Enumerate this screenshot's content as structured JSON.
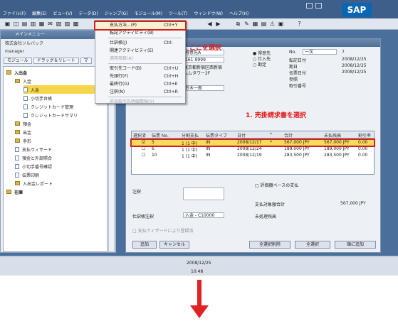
{
  "menubar": {
    "items": [
      "ファイル(F)",
      "編集(E)",
      "ビュー(V)",
      "データ(D)",
      "ジャンプ(G)",
      "モジュール(M)",
      "ツール(T)",
      "ウィンドウ(W)",
      "ヘルプ(H)"
    ],
    "logo": "SAP"
  },
  "left_panel": {
    "title": "メインメニュー",
    "company": "株式会社ソルパック",
    "user": "manager",
    "tabs": [
      "モジュール",
      "ドラッグ＆リレート",
      "マ"
    ],
    "tree": [
      {
        "label": "入出金",
        "level": 0,
        "kind": "folder"
      },
      {
        "label": "入金",
        "level": 1,
        "kind": "folder"
      },
      {
        "label": "入金",
        "level": 2,
        "kind": "doc",
        "selected": true
      },
      {
        "label": "小切手台帳",
        "level": 2,
        "kind": "doc"
      },
      {
        "label": "クレジットカード管理",
        "level": 2,
        "kind": "doc"
      },
      {
        "label": "クレジットカードサマリ",
        "level": 2,
        "kind": "doc"
      },
      {
        "label": "預金",
        "level": 1,
        "kind": "folder"
      },
      {
        "label": "出金",
        "level": 1,
        "kind": "folder"
      },
      {
        "label": "手形",
        "level": 1,
        "kind": "folder"
      },
      {
        "label": "支払ウィザード",
        "level": 1,
        "kind": "doc"
      },
      {
        "label": "預金と外部照合",
        "level": 1,
        "kind": "doc"
      },
      {
        "label": "小切手番号確認",
        "level": 1,
        "kind": "doc"
      },
      {
        "label": "伝票印刷",
        "level": 1,
        "kind": "doc"
      },
      {
        "label": "入出金レポート",
        "level": 1,
        "kind": "folder"
      },
      {
        "label": "在庫",
        "level": 0,
        "kind": "folder"
      }
    ]
  },
  "context_menu": {
    "items": [
      {
        "label": "支払方法...(P)",
        "shortcut": "Ctrl+Y",
        "highlighted": true
      },
      {
        "label": "転記アクティビティ(B)"
      },
      {
        "label": "仕訳帳(J)",
        "shortcut": "Ctrl-"
      },
      {
        "label": "関連アクティビティ(E)"
      },
      {
        "label": "適用項目(A)",
        "disabled": true
      },
      {
        "label": "取引先コード(B)",
        "shortcut": "Ctrl+U"
      },
      {
        "label": "先頭行(F)",
        "shortcut": "Ctrl+H"
      },
      {
        "label": "最終行(G)",
        "shortcut": "Ctrl+E"
      },
      {
        "label": "注釈(N)",
        "shortcut": "Ctrl+R"
      },
      {
        "label": "追加取引先明細情報(Y)",
        "disabled": true
      }
    ]
  },
  "annotations": {
    "step2": "2. ここを選択",
    "step1": "1. 売掛請求書を選択"
  },
  "form": {
    "header": {
      "partner_code": "得意先A",
      "phone": "161-9999",
      "address1": "東京都新宿区西新宿",
      "address2": "ムムタワー2F",
      "contact": "鈴木一郎",
      "radio_customer": "得意先",
      "radio_vendor": "仕入先",
      "radio_account": "勘定",
      "no_label": "No.",
      "no_series": "一次",
      "no_value": "7",
      "posting_date_label": "転記日付",
      "posting_date": "2008/12/25",
      "due_date_label": "期日",
      "due_date": "2008/12/25",
      "doc_date_label": "伝票日付",
      "doc_date": "2008/12/25",
      "reference_label": "参照",
      "transaction_no_label": "取引番号"
    },
    "grid": {
      "columns": [
        "選択済",
        "伝票 No.",
        "分割支払",
        "伝票タイプ",
        "日付",
        "*",
        "合計",
        "未払残高",
        "割引率"
      ],
      "rows": [
        {
          "selected": true,
          "doc_no": "5",
          "installment": "1 (1 中)",
          "type": "IN",
          "date": "2008/12/17",
          "flag": "*",
          "total": "567,000 JPY",
          "balance": "567,000 JPY",
          "discount": "0.00"
        },
        {
          "selected": false,
          "doc_no": "6",
          "installment": "1 (1 中)",
          "type": "IN",
          "date": "2008/12/24",
          "flag": "",
          "total": "189,000 JPY",
          "balance": "189,000 JPY",
          "discount": "0.00"
        },
        {
          "selected": false,
          "doc_no": "10",
          "installment": "1 (1 中)",
          "type": "IN",
          "date": "2008/12/19",
          "flag": "",
          "total": "283,500 JPY",
          "balance": "283,500 JPY",
          "discount": "0.00"
        }
      ]
    },
    "footer": {
      "remark_label": "注釈",
      "journal_remark_label": "仕訳帳注釈",
      "journal_remark_value": "入金 - C10000",
      "wizard_check_label": "支払ウィザードにより登録済",
      "openbalance_check_label": "評価額ベースの支払",
      "total_label": "支払対象額合計",
      "total_value": "567,000 JPY",
      "outstanding_label": "未処理残高"
    },
    "buttons": {
      "add": "追加",
      "cancel": "キャンセル",
      "clear_selection": "全選択削除",
      "select_all": "全選択",
      "auto_add": "順に追加"
    }
  },
  "status": {
    "date": "2008/12/25",
    "time": "10:48"
  }
}
